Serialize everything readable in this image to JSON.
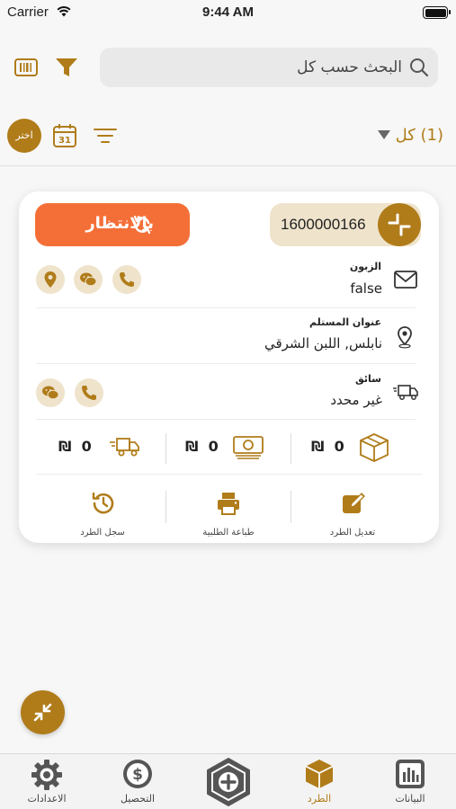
{
  "status_bar": {
    "carrier": "Carrier",
    "time": "9:44 AM"
  },
  "search": {
    "placeholder": "البحث حسب كل"
  },
  "toolbar": {
    "choose_label": "اختر",
    "count_label": "(1) كل"
  },
  "card": {
    "status_label": "بالانتظار",
    "parcel_number": "1600000166",
    "customer": {
      "label": "الزبون",
      "value": "false"
    },
    "address": {
      "label": "عنوان المستلم",
      "value": "نابلس, اللبن الشرقي"
    },
    "driver": {
      "label": "سائق",
      "value": "غير محدد"
    },
    "stats": [
      {
        "value": "0",
        "currency": "₪"
      },
      {
        "value": "0",
        "currency": "₪"
      },
      {
        "value": "0",
        "currency": "₪"
      }
    ],
    "actions": {
      "edit": "تعديل الطرد",
      "print": "طباعة الطلبية",
      "history": "سجل الطرد"
    }
  },
  "tabs": {
    "settings": "الاعدادات",
    "collection": "التحصيل",
    "parcel": "الطرد",
    "data": "البيانات"
  },
  "colors": {
    "accent": "#b07c1a",
    "status": "#f46f38",
    "accent_light": "#efe3cc"
  }
}
